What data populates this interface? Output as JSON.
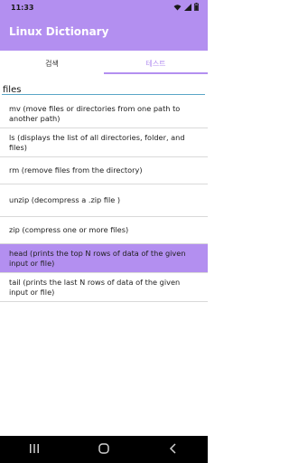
{
  "status": {
    "time": "11:33"
  },
  "app": {
    "title": "Linux Dictionary"
  },
  "tabs": [
    {
      "label": "검색",
      "active": false
    },
    {
      "label": "테스트",
      "active": true
    }
  ],
  "search": {
    "value": "files"
  },
  "results": [
    {
      "text": "mv (move files or directories from one path to another path)",
      "selected": false
    },
    {
      "text": "ls (displays the list of all directories, folder, and files)",
      "selected": false
    },
    {
      "text": "rm (remove files from the directory)",
      "selected": false
    },
    {
      "text": "unzip (decompress a .zip file )",
      "selected": false
    },
    {
      "text": "zip (compress one or more files)",
      "selected": false
    },
    {
      "text": "head (prints the top N rows of data of the given input or file)",
      "selected": true
    },
    {
      "text": "tail (prints the last N rows of data of the given input or file)",
      "selected": false
    }
  ],
  "colors": {
    "accent": "#b38ff0",
    "input_underline": "#5aa6c7"
  },
  "icons": {
    "status": [
      "wifi-icon",
      "signal-icon",
      "battery-icon"
    ],
    "nav": [
      "recents-icon",
      "home-icon",
      "back-icon"
    ]
  }
}
